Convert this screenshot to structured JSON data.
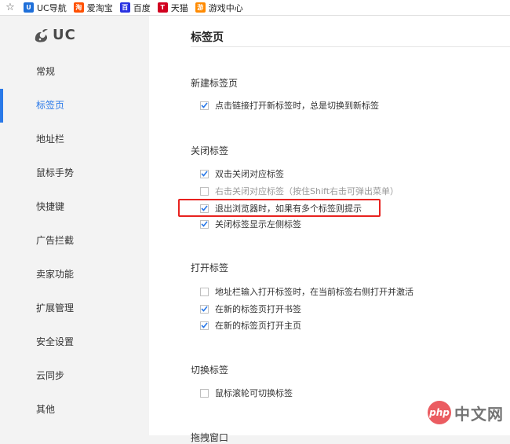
{
  "bookmarks_bar": {
    "items": [
      {
        "label": "UC导航",
        "icon": "uc-nav-icon",
        "color": "#1e6fd9",
        "glyph": "U"
      },
      {
        "label": "爱淘宝",
        "icon": "taobao-icon",
        "color": "#ff5000",
        "glyph": "淘"
      },
      {
        "label": "百度",
        "icon": "baidu-paw-icon",
        "color": "#2932e1",
        "glyph": "百"
      },
      {
        "label": "天猫",
        "icon": "tmall-icon",
        "color": "#d1001f",
        "glyph": "T"
      },
      {
        "label": "游戏中心",
        "icon": "game-center-icon",
        "color": "#ff8a00",
        "glyph": "游"
      }
    ]
  },
  "sidebar": {
    "logo_text": "UC",
    "active_index": 1,
    "items": [
      {
        "label": "常规"
      },
      {
        "label": "标签页"
      },
      {
        "label": "地址栏"
      },
      {
        "label": "鼠标手势"
      },
      {
        "label": "快捷键"
      },
      {
        "label": "广告拦截"
      },
      {
        "label": "卖家功能"
      },
      {
        "label": "扩展管理"
      },
      {
        "label": "安全设置"
      },
      {
        "label": "云同步"
      },
      {
        "label": "其他"
      }
    ]
  },
  "main": {
    "page_title": "标签页",
    "sections": [
      {
        "title": "新建标签页",
        "options": [
          {
            "label": "点击链接打开新标签时，总是切换到新标签",
            "checked": true
          }
        ]
      },
      {
        "title": "关闭标签",
        "options": [
          {
            "label": "双击关闭对应标签",
            "checked": true
          },
          {
            "label": "右击关闭对应标签（按住Shift右击可弹出菜单）",
            "checked": false
          },
          {
            "label": "退出浏览器时，如果有多个标签则提示",
            "checked": true
          },
          {
            "label": "关闭标签显示左侧标签",
            "checked": true
          }
        ]
      },
      {
        "title": "打开标签",
        "options": [
          {
            "label": "地址栏输入打开标签时，在当前标签右侧打开并激活",
            "checked": false
          },
          {
            "label": "在新的标签页打开书签",
            "checked": true
          },
          {
            "label": "在新的标签页打开主页",
            "checked": true
          }
        ]
      },
      {
        "title": "切换标签",
        "options": [
          {
            "label": "鼠标滚轮可切换标签",
            "checked": false
          }
        ]
      }
    ],
    "cut_section_title": "拖拽窗口"
  },
  "watermark": {
    "logo_text": "php",
    "text": "中文网"
  },
  "colors": {
    "accent": "#2a79e8",
    "highlight": "#e8221f",
    "checkmark": "#2a79e8"
  }
}
